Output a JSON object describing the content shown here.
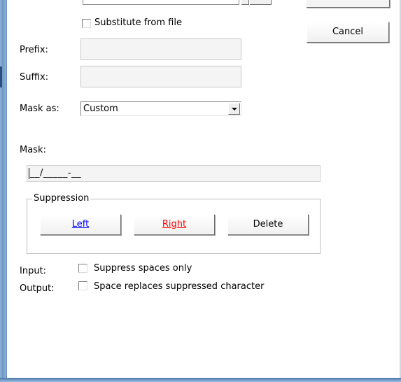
{
  "substitute_from_file": {
    "label": "Substitute from file",
    "checked": false
  },
  "buttons": {
    "cancel": "Cancel"
  },
  "prefix": {
    "label": "Prefix:",
    "value": ""
  },
  "suffix": {
    "label": "Suffix:",
    "value": ""
  },
  "mask_as": {
    "label": "Mask as:",
    "selected": "Custom"
  },
  "mask": {
    "label": "Mask:",
    "value": "__/_____-__"
  },
  "suppression": {
    "title": "Suppression",
    "left": "Left",
    "right": "Right",
    "delete": "Delete",
    "colors": {
      "left": "#0000ff",
      "right": "#ff0000"
    }
  },
  "input_row": {
    "label": "Input:",
    "option": "Suppress spaces only",
    "checked": false
  },
  "output_row": {
    "label": "Output:",
    "option": "Space replaces suppressed character",
    "checked": false
  }
}
